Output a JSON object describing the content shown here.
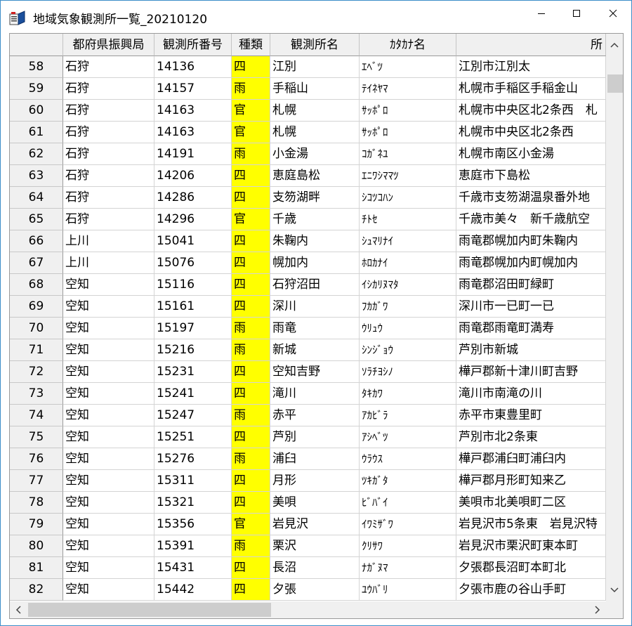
{
  "window": {
    "title": "地域気象観測所一覧_20210120"
  },
  "columns": [
    "都府県振興局",
    "観測所番号",
    "種類",
    "観測所名",
    "ｶﾀｶﾅ名",
    "所"
  ],
  "type_highlight_color": "#ffff00",
  "rows": [
    {
      "n": "58",
      "pref": "石狩",
      "num": "14136",
      "type": "四",
      "name": "江別",
      "kana": "ｴﾍﾞﾂ",
      "addr": "江別市江別太"
    },
    {
      "n": "59",
      "pref": "石狩",
      "num": "14157",
      "type": "雨",
      "name": "手稲山",
      "kana": "ﾃｲﾈﾔﾏ",
      "addr": "札幌市手稲区手稲金山"
    },
    {
      "n": "60",
      "pref": "石狩",
      "num": "14163",
      "type": "官",
      "name": "札幌",
      "kana": "ｻｯﾎﾟﾛ",
      "addr": "札幌市中央区北2条西　札"
    },
    {
      "n": "61",
      "pref": "石狩",
      "num": "14163",
      "type": "官",
      "name": "札幌",
      "kana": "ｻｯﾎﾟﾛ",
      "addr": "札幌市中央区北2条西"
    },
    {
      "n": "62",
      "pref": "石狩",
      "num": "14191",
      "type": "雨",
      "name": "小金湯",
      "kana": "ｺｶﾞﾈﾕ",
      "addr": "札幌市南区小金湯"
    },
    {
      "n": "63",
      "pref": "石狩",
      "num": "14206",
      "type": "四",
      "name": "恵庭島松",
      "kana": "ｴﾆﾜｼﾏﾏﾂ",
      "addr": "恵庭市下島松"
    },
    {
      "n": "64",
      "pref": "石狩",
      "num": "14286",
      "type": "四",
      "name": "支笏湖畔",
      "kana": "ｼｺﾂｺﾊﾝ",
      "addr": "千歳市支笏湖温泉番外地"
    },
    {
      "n": "65",
      "pref": "石狩",
      "num": "14296",
      "type": "官",
      "name": "千歳",
      "kana": "ﾁﾄｾ",
      "addr": "千歳市美々　新千歳航空"
    },
    {
      "n": "66",
      "pref": "上川",
      "num": "15041",
      "type": "四",
      "name": "朱鞠内",
      "kana": "ｼｭﾏﾘﾅｲ",
      "addr": "雨竜郡幌加内町朱鞠内"
    },
    {
      "n": "67",
      "pref": "上川",
      "num": "15076",
      "type": "四",
      "name": "幌加内",
      "kana": "ﾎﾛｶﾅｲ",
      "addr": "雨竜郡幌加内町幌加内"
    },
    {
      "n": "68",
      "pref": "空知",
      "num": "15116",
      "type": "四",
      "name": "石狩沼田",
      "kana": "ｲｼｶﾘﾇﾏﾀ",
      "addr": "雨竜郡沼田町緑町"
    },
    {
      "n": "69",
      "pref": "空知",
      "num": "15161",
      "type": "四",
      "name": "深川",
      "kana": "ﾌｶｶﾞﾜ",
      "addr": "深川市一已町一已"
    },
    {
      "n": "70",
      "pref": "空知",
      "num": "15197",
      "type": "雨",
      "name": "雨竜",
      "kana": "ｳﾘｭｳ",
      "addr": "雨竜郡雨竜町満寿"
    },
    {
      "n": "71",
      "pref": "空知",
      "num": "15216",
      "type": "雨",
      "name": "新城",
      "kana": "ｼﾝｼﾞｮｳ",
      "addr": "芦別市新城"
    },
    {
      "n": "72",
      "pref": "空知",
      "num": "15231",
      "type": "四",
      "name": "空知吉野",
      "kana": "ｿﾗﾁﾖｼﾉ",
      "addr": "樺戸郡新十津川町吉野"
    },
    {
      "n": "73",
      "pref": "空知",
      "num": "15241",
      "type": "四",
      "name": "滝川",
      "kana": "ﾀｷｶﾜ",
      "addr": "滝川市南滝の川"
    },
    {
      "n": "74",
      "pref": "空知",
      "num": "15247",
      "type": "雨",
      "name": "赤平",
      "kana": "ｱｶﾋﾞﾗ",
      "addr": "赤平市東豊里町"
    },
    {
      "n": "75",
      "pref": "空知",
      "num": "15251",
      "type": "四",
      "name": "芦別",
      "kana": "ｱｼﾍﾞﾂ",
      "addr": "芦別市北2条東"
    },
    {
      "n": "76",
      "pref": "空知",
      "num": "15276",
      "type": "雨",
      "name": "浦臼",
      "kana": "ｳﾗｳｽ",
      "addr": "樺戸郡浦臼町浦臼内"
    },
    {
      "n": "77",
      "pref": "空知",
      "num": "15311",
      "type": "四",
      "name": "月形",
      "kana": "ﾂｷｶﾞﾀ",
      "addr": "樺戸郡月形町知来乙"
    },
    {
      "n": "78",
      "pref": "空知",
      "num": "15321",
      "type": "四",
      "name": "美唄",
      "kana": "ﾋﾞﾊﾞｲ",
      "addr": "美唄市北美唄町二区"
    },
    {
      "n": "79",
      "pref": "空知",
      "num": "15356",
      "type": "官",
      "name": "岩見沢",
      "kana": "ｲﾜﾐｻﾞﾜ",
      "addr": "岩見沢市5条東　岩見沢特"
    },
    {
      "n": "80",
      "pref": "空知",
      "num": "15391",
      "type": "雨",
      "name": "栗沢",
      "kana": "ｸﾘｻﾜ",
      "addr": "岩見沢市栗沢町東本町"
    },
    {
      "n": "81",
      "pref": "空知",
      "num": "15431",
      "type": "四",
      "name": "長沼",
      "kana": "ﾅｶﾞﾇﾏ",
      "addr": "夕張郡長沼町本町北"
    },
    {
      "n": "82",
      "pref": "空知",
      "num": "15442",
      "type": "四",
      "name": "夕張",
      "kana": "ﾕｳﾊﾞﾘ",
      "addr": "夕張市鹿の谷山手町"
    }
  ]
}
